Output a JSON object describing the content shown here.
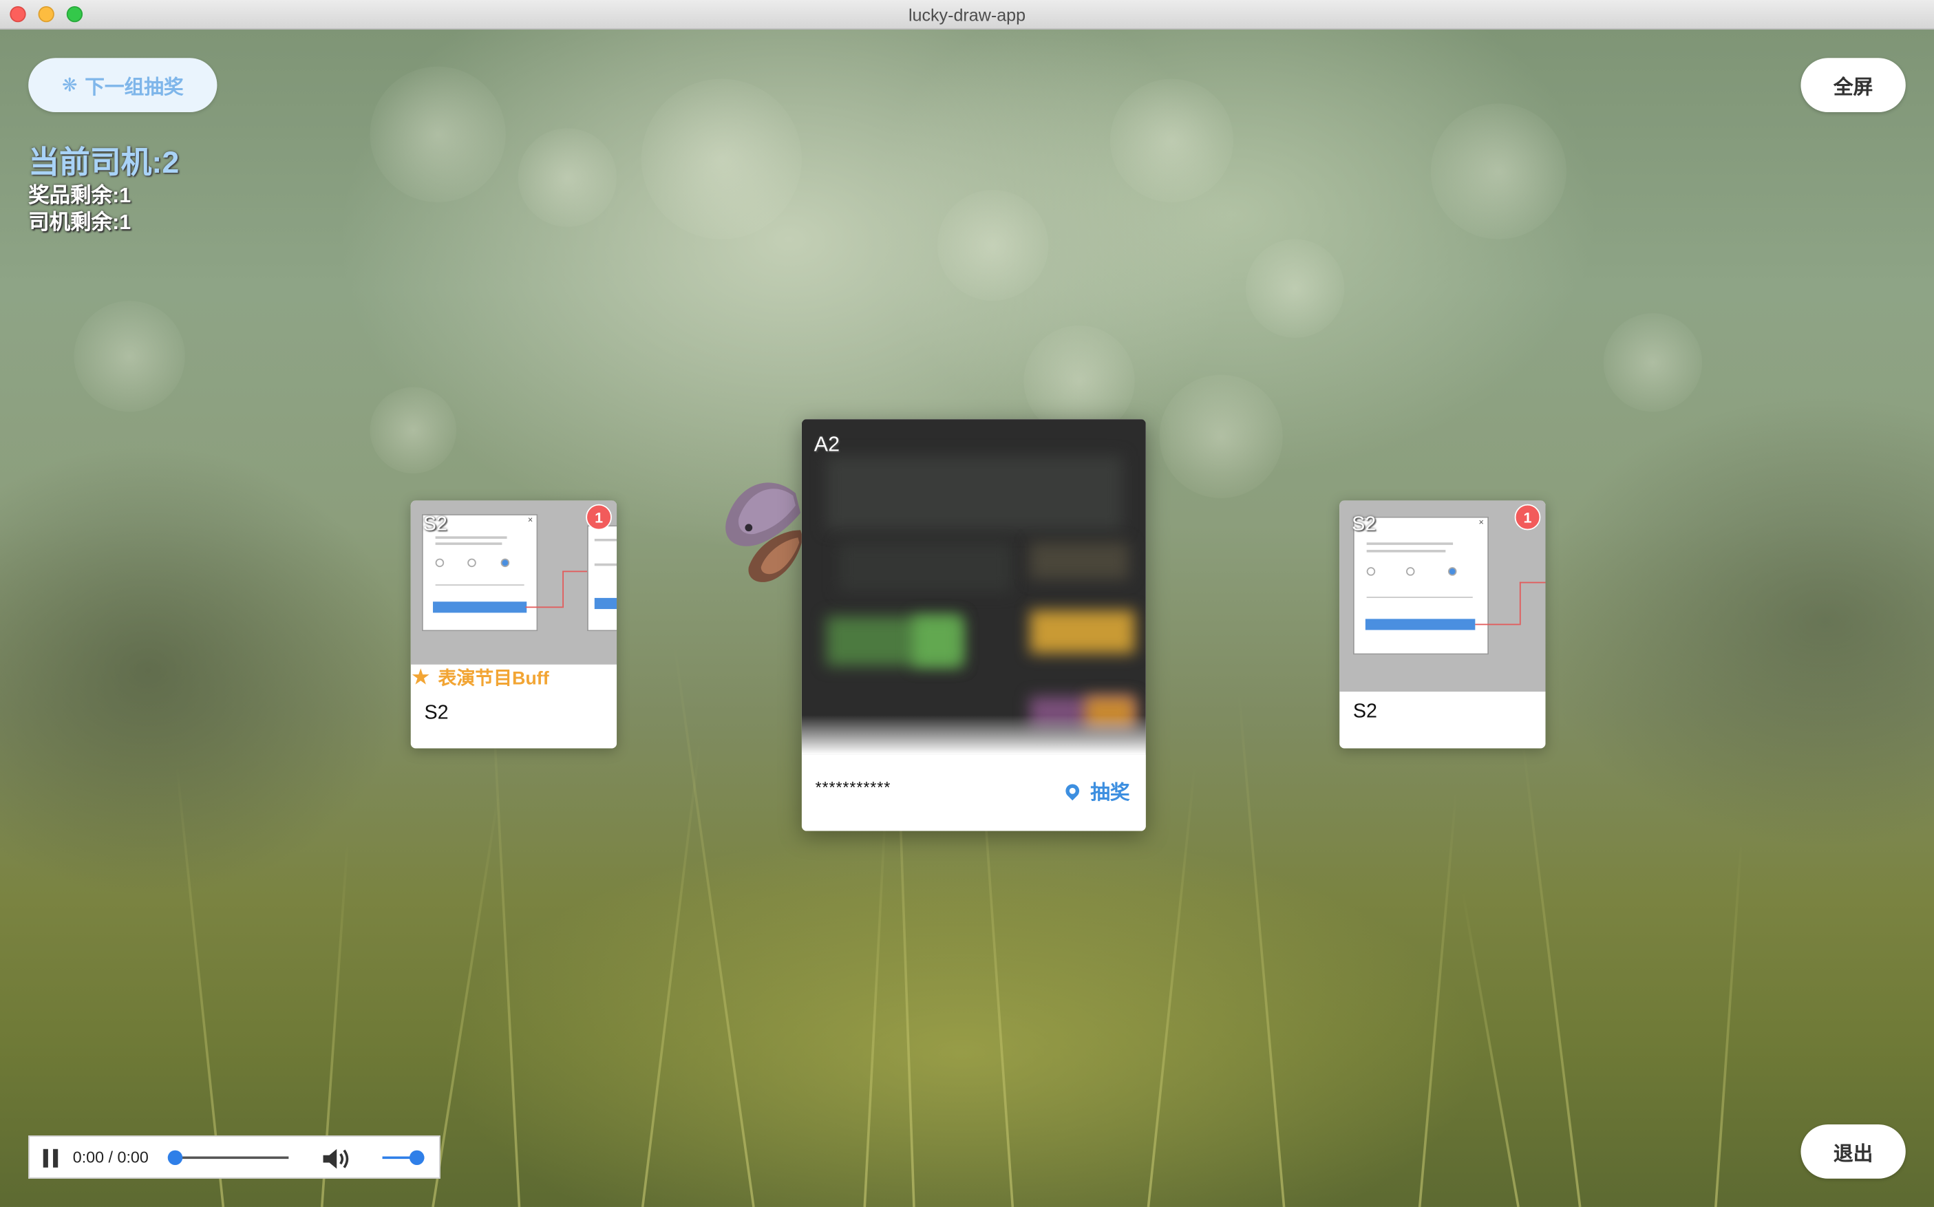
{
  "window": {
    "title": "lucky-draw-app"
  },
  "toolbar": {
    "next_group_label": "下一组抽奖",
    "fullscreen_label": "全屏",
    "exit_label": "退出"
  },
  "status": {
    "current_driver": "当前司机:2",
    "prizes_remaining": "奖品剩余:1",
    "drivers_remaining": "司机剩余:1"
  },
  "cards": {
    "left": {
      "corner_label": "S2",
      "badge": "1",
      "buff_label": "表演节目Buff",
      "name": "S2"
    },
    "center": {
      "corner_label": "A2",
      "masked_id": "***********",
      "action_label": "抽奖"
    },
    "right": {
      "corner_label": "S2",
      "badge": "1",
      "name": "S2"
    }
  },
  "player": {
    "time": "0:00 / 0:00",
    "state": "paused",
    "seek_fraction": 0,
    "volume_fraction": 1
  },
  "colors": {
    "accent_blue": "#3d8fe0",
    "buff_orange": "#f2a534",
    "badge_red": "#f25b5b",
    "next_btn_text": "#7fb6ea"
  },
  "icons": {
    "next_group": "spinner-icon",
    "buff": "star-icon",
    "draw": "location-pin-icon",
    "pause": "pause-icon",
    "volume": "speaker-icon"
  }
}
